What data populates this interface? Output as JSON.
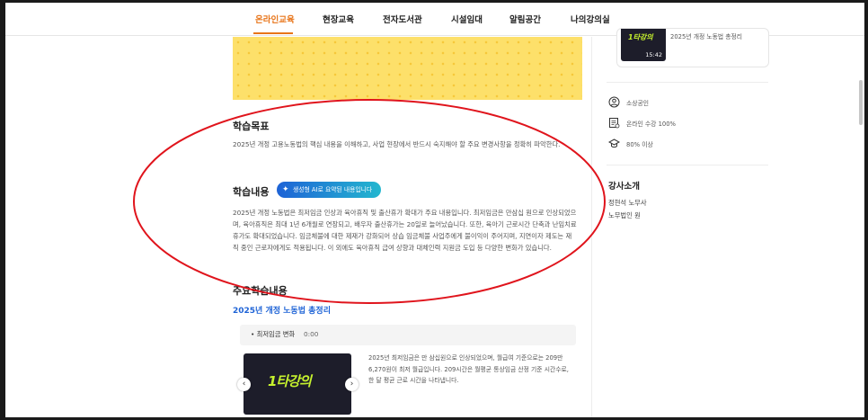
{
  "nav": {
    "items": [
      {
        "label": "온라인교육",
        "active": true
      },
      {
        "label": "현장교육",
        "active": false
      },
      {
        "label": "전자도서관",
        "active": false
      },
      {
        "label": "시설임대",
        "active": false
      },
      {
        "label": "알림공간",
        "active": false
      },
      {
        "label": "나의강의실",
        "active": false
      }
    ]
  },
  "objective": {
    "heading": "학습목표",
    "text": "2025년 개정 고용노동법의 핵심 내용을 이해하고, 사업 현장에서 반드시 숙지해야 할 주요 변경사항을 정확히 파악한다."
  },
  "content": {
    "heading": "학습내용",
    "ai_button": "생성형 AI로 요약된 내용입니다",
    "text": "2025년 개정 노동법은 최저임금 인상과 육아휴직 및 출산휴가 확대가 주요 내용입니다. 최저임금은 만삼십 원으로 인상되었으며, 육아휴직은 최대 1년 6개월로 연장되고, 배우자 출산휴가는 20일로 늘어났습니다. 또한, 육아기 근로시간 단축과 난임치료휴가도 확대되었습니다. 임금체불에 대한 제재가 강화되어 상습 임금체불 사업주에게 불이익이 주어지며, 지연이자 제도는 재직 중인 근로자에게도 적용됩니다. 이 외에도 육아휴직 급여 상향과 대체인력 지원금 도입 등 다양한 변화가 있습니다."
  },
  "key": {
    "heading": "주요학습내용",
    "link": "2025년 개정 노동법 총정리",
    "chapter_title": "최저임금 변화",
    "chapter_time": "0:00",
    "video_logo": "1타강의",
    "video_desc": "2025년 최저임금은 만 삼십원으로 인상되었으며, 월급여 기준으로는 209만 6,270원이 최저 월급입니다. 209시간은 월평균 통상임금 산정 기준 시간수로, 한 달 평균 근로 시간을 나타냅니다."
  },
  "sidebar": {
    "mini_card": {
      "logo": "1타강의",
      "duration": "15:42",
      "title": "2025년 개정 노동법 총정리"
    },
    "info": [
      {
        "icon": "person-icon",
        "text": "소상공인"
      },
      {
        "icon": "certificate-icon",
        "text": "온라인 수강 100%"
      },
      {
        "icon": "graduation-cap-icon",
        "text": "80% 이상"
      }
    ],
    "instructor_heading": "강사소개",
    "instructor_name": "정현석 노무사",
    "instructor_org": "노무법인 원"
  },
  "colors": {
    "accent": "#e8751a",
    "link": "#1e63d6",
    "annotation": "#e0141c",
    "banner": "#fde06a"
  }
}
